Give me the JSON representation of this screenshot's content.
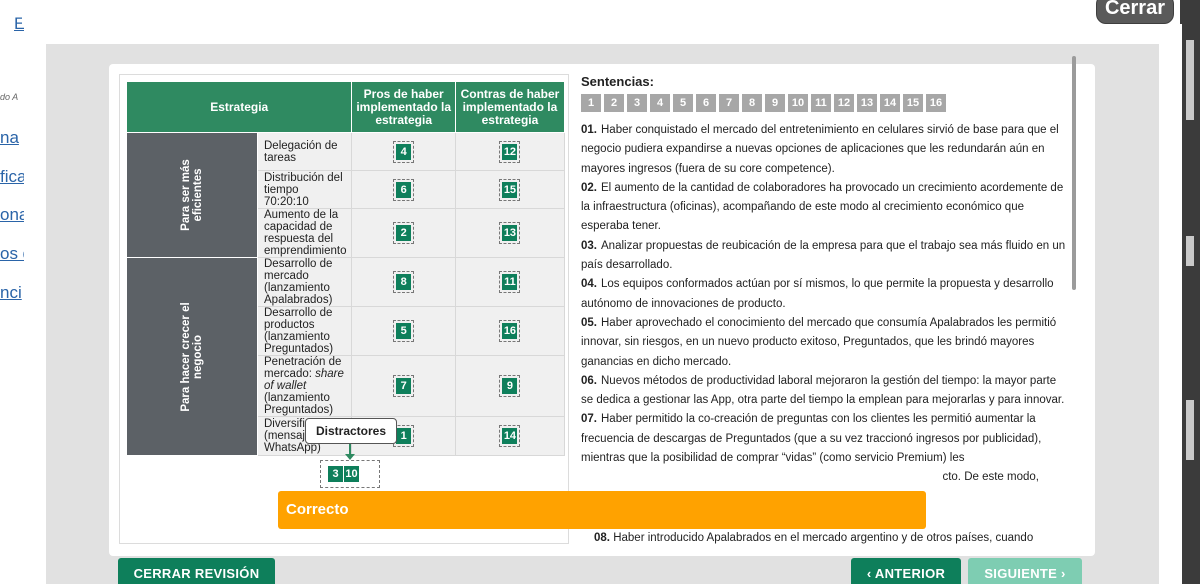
{
  "background": {
    "links": [
      "E",
      "na",
      "fica",
      "ona",
      "os d",
      "nci"
    ],
    "small_text": "do A"
  },
  "header": {
    "close_label": "Cerrar"
  },
  "table": {
    "headers": {
      "strategy": "Estrategia",
      "pros": "Pros de haber implementado la estrategia",
      "cons": "Contras de haber implementado la estrategia"
    },
    "groups": [
      {
        "label": "Para ser más eficientes",
        "rows": [
          {
            "strategy": "Delegación de tareas",
            "pro": "4",
            "con": "12"
          },
          {
            "strategy": "Distribución del tiempo 70:20:10",
            "pro": "6",
            "con": "15"
          },
          {
            "strategy": "Aumento de la capacidad de respuesta del emprendimiento",
            "pro": "2",
            "con": "13"
          }
        ]
      },
      {
        "label": "Para hacer crecer el negocio",
        "rows": [
          {
            "strategy": "Desarrollo de mercado (lanzamiento Apalabrados)",
            "pro": "8",
            "con": "11"
          },
          {
            "strategy": "Desarrollo de productos (lanzamiento Preguntados)",
            "pro": "5",
            "con": "16"
          },
          {
            "strategy_italic": "share of wallet",
            "strategy_prefix": "Penetración de mercado: ",
            "strategy_suffix": " (lanzamiento Preguntados)",
            "pro": "7",
            "con": "9"
          },
          {
            "strategy": "Diversificación (mensajería tipo WhatsApp)",
            "pro": "1",
            "con": "14"
          }
        ]
      }
    ]
  },
  "distractors": {
    "label": "Distractores",
    "items": [
      "3",
      "10"
    ]
  },
  "sentences": {
    "title": "Sentencias:",
    "numbers": [
      "1",
      "2",
      "3",
      "4",
      "5",
      "6",
      "7",
      "8",
      "9",
      "10",
      "11",
      "12",
      "13",
      "14",
      "15",
      "16"
    ],
    "items": [
      {
        "num": "01.",
        "text": "Haber conquistado el mercado del entretenimiento en celulares sirvió de base para que el negocio pudiera expandirse a nuevas opciones de aplicaciones que les redundarán aún en mayores ingresos (fuera de su core competence)."
      },
      {
        "num": "02.",
        "text": "El aumento de la cantidad de colaboradores ha provocado un crecimiento acordemente de la infraestructura (oficinas), acompañando de este modo al crecimiento económico que esperaba tener."
      },
      {
        "num": "03.",
        "text": "Analizar propuestas de reubicación de la empresa para que el trabajo sea más fluido en un país desarrollado."
      },
      {
        "num": "04.",
        "text": "Los equipos conformados actúan por sí mismos, lo que permite la propuesta y desarrollo autónomo de innovaciones de producto."
      },
      {
        "num": "05.",
        "text": "Haber aprovechado el conocimiento del mercado que consumía Apalabrados les permitió innovar, sin riesgos, en un nuevo producto exitoso, Preguntados, que les brindó mayores ganancias en dicho mercado."
      },
      {
        "num": "06.",
        "text": "Nuevos métodos de productividad laboral mejoraron la gestión del tiempo: la mayor parte se dedica a gestionar las App, otra parte del tiempo la emplean para mejorarlas y para innovar."
      },
      {
        "num": "07.",
        "text": "Haber permitido la co-creación de preguntas con los clientes les permitió aumentar la frecuencia de descargas de Preguntados (que a su vez traccionó ingresos por publicidad), mientras que la posibilidad de comprar “vidas” (como servicio Premium) les"
      },
      {
        "num": "",
        "text": "cto. De este modo,"
      }
    ],
    "last": {
      "num": "08.",
      "text": "Haber introducido Apalabrados en el mercado argentino y de otros países, cuando"
    }
  },
  "toast": {
    "label": "Correcto"
  },
  "footer": {
    "close_review": "CERRAR REVISIÓN",
    "previous": "ANTERIOR",
    "next": "SIGUIENTE",
    "previous_arrow": "‹",
    "next_arrow": "›"
  },
  "colors": {
    "green": "#0e7f5b",
    "header_green": "#2f8a61",
    "toast": "#ffa200",
    "disabled_green": "#7ecdb2"
  }
}
